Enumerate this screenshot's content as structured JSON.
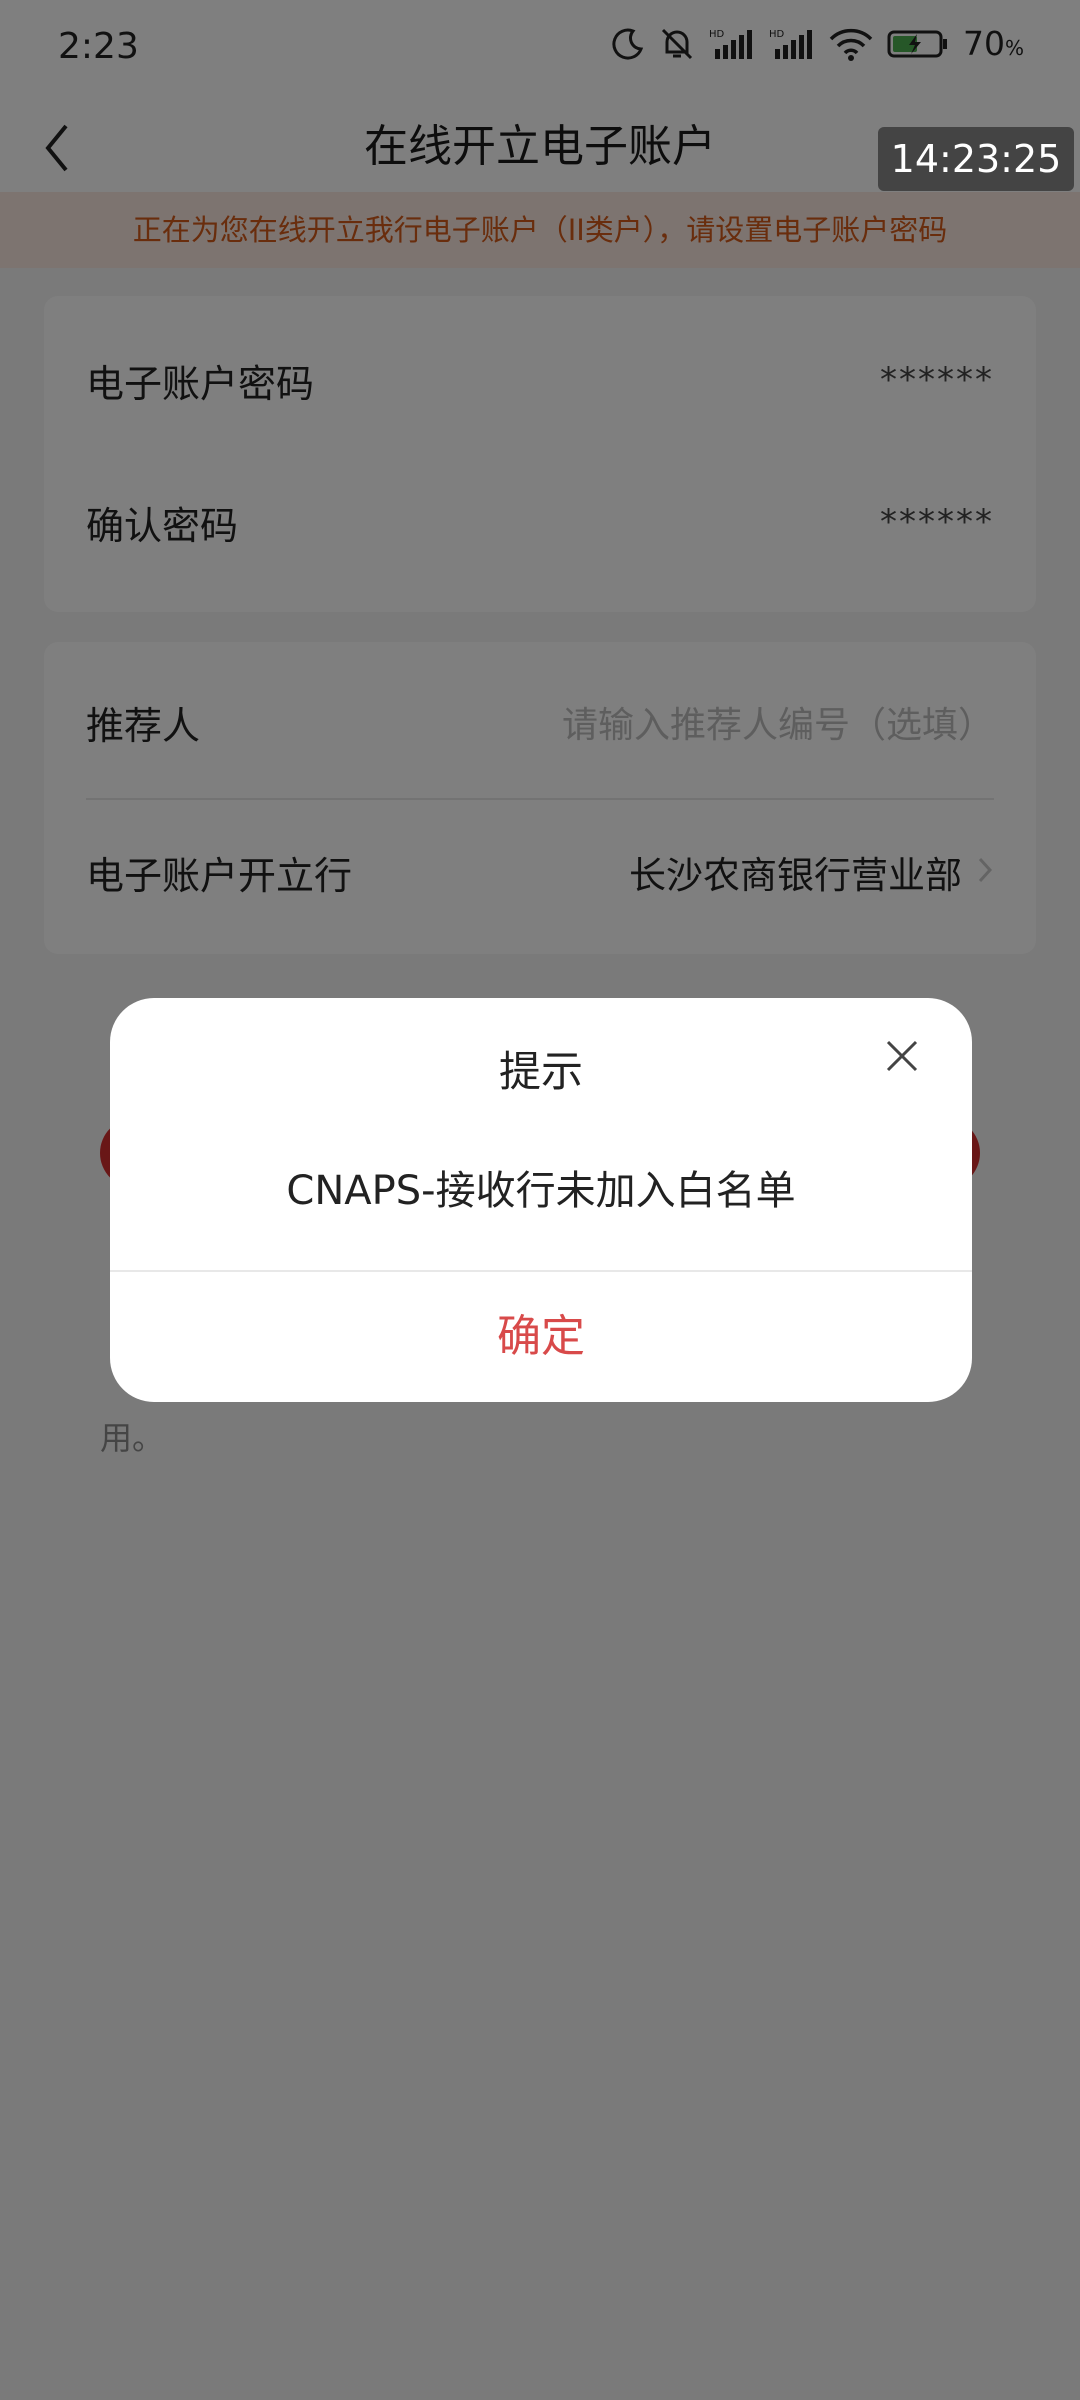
{
  "status_bar": {
    "time": "2:23",
    "battery_percent": "70",
    "battery_unit": "%",
    "icons": [
      "moon-icon",
      "bell-off-icon",
      "hd-signal-icon",
      "hd-signal-icon",
      "wifi-icon",
      "battery-charging-icon"
    ]
  },
  "nav": {
    "title": "在线开立电子账户"
  },
  "time_overlay": "14:23:25",
  "notice": "正在为您在线开立我行电子账户（II类户），请设置电子账户密码",
  "form": {
    "password_label": "电子账户密码",
    "password_value": "******",
    "confirm_label": "确认密码",
    "confirm_value": "******",
    "referrer_label": "推荐人",
    "referrer_placeholder": "请输入推荐人编号（选填）",
    "branch_label": "电子账户开立行",
    "branch_value": "长沙农商银行营业部"
  },
  "tip": {
    "tail": "用。"
  },
  "dialog": {
    "title": "提示",
    "message": "CNAPS-接收行未加入白名单",
    "confirm": "确定"
  },
  "colors": {
    "accent_red": "#d84a4a",
    "notice_text": "#d35a1a",
    "notice_bg": "#fbe9e0"
  }
}
